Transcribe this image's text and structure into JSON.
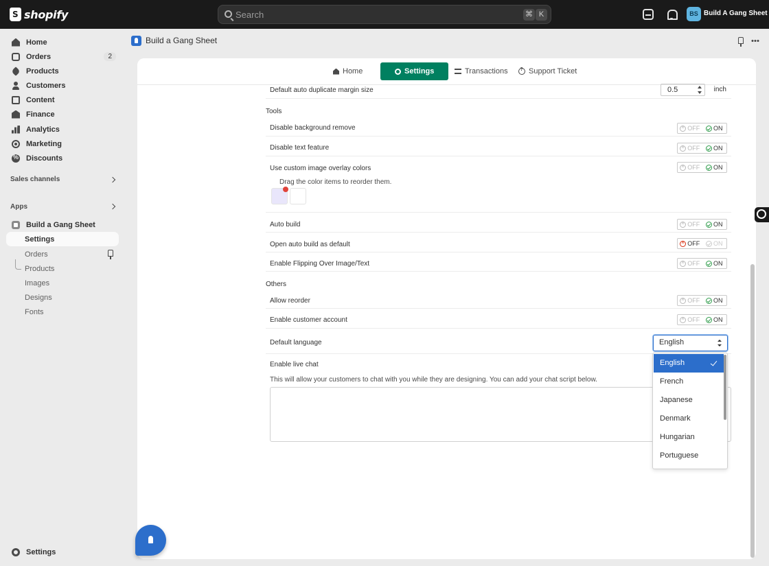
{
  "topbar": {
    "logo_text": "shopify",
    "search_placeholder": "Search",
    "kbd_cmd": "⌘",
    "kbd_k": "K",
    "store_initials": "BS",
    "store_name": "Build A Gang Sheet"
  },
  "sidebar": {
    "items": [
      {
        "label": "Home",
        "icon": "home-icon"
      },
      {
        "label": "Orders",
        "icon": "orders-icon",
        "badge": "2"
      },
      {
        "label": "Products",
        "icon": "tag-icon"
      },
      {
        "label": "Customers",
        "icon": "person-icon"
      },
      {
        "label": "Content",
        "icon": "content-icon"
      },
      {
        "label": "Finance",
        "icon": "bank-icon"
      },
      {
        "label": "Analytics",
        "icon": "chart-icon"
      },
      {
        "label": "Marketing",
        "icon": "target-icon"
      },
      {
        "label": "Discounts",
        "icon": "discount-icon"
      }
    ],
    "sales_channels_label": "Sales channels",
    "apps_label": "Apps",
    "app_name": "Build a Gang Sheet",
    "app_subitems": [
      "Settings",
      "Orders",
      "Products",
      "Images",
      "Designs",
      "Fonts"
    ],
    "settings_label": "Settings"
  },
  "app_header": {
    "title": "Build a Gang Sheet"
  },
  "tabs": [
    {
      "label": "Home",
      "active": false
    },
    {
      "label": "Settings",
      "active": true
    },
    {
      "label": "Transactions",
      "active": false
    },
    {
      "label": "Support Ticket",
      "active": false
    }
  ],
  "settings": {
    "margin_label": "Default auto duplicate margin size",
    "margin_value": "0.5",
    "margin_unit": "inch",
    "tools_title": "Tools",
    "tools": [
      {
        "label": "Disable background remove",
        "value": "ON"
      },
      {
        "label": "Disable text feature",
        "value": "ON"
      },
      {
        "label": "Use custom image overlay colors",
        "value": "ON"
      }
    ],
    "color_hint": "Drag the color items to reorder them.",
    "swatch_colors": [
      "#e9e6fb",
      "#ffffff"
    ],
    "tools2": [
      {
        "label": "Auto build",
        "value": "ON"
      },
      {
        "label": "Open auto build as default",
        "value": "OFF"
      },
      {
        "label": "Enable Flipping Over Image/Text",
        "value": "ON"
      }
    ],
    "others_title": "Others",
    "others": [
      {
        "label": "Allow reorder",
        "value": "ON"
      },
      {
        "label": "Enable customer account",
        "value": "ON"
      }
    ],
    "language_label": "Default language",
    "language_value": "English",
    "live_chat_label": "Enable live chat",
    "live_chat_hint": "This will allow your customers to chat with you while they are designing. You can add your chat script below.",
    "toggle_off_text": "OFF",
    "toggle_on_text": "ON"
  },
  "language_dropdown": {
    "options": [
      "English",
      "French",
      "Japanese",
      "Denmark",
      "Hungarian",
      "Portuguese"
    ],
    "selected": "English"
  },
  "colors": {
    "accent_green": "#008060",
    "select_blue": "#2c6ecb",
    "topbar": "#1a1a1a"
  }
}
